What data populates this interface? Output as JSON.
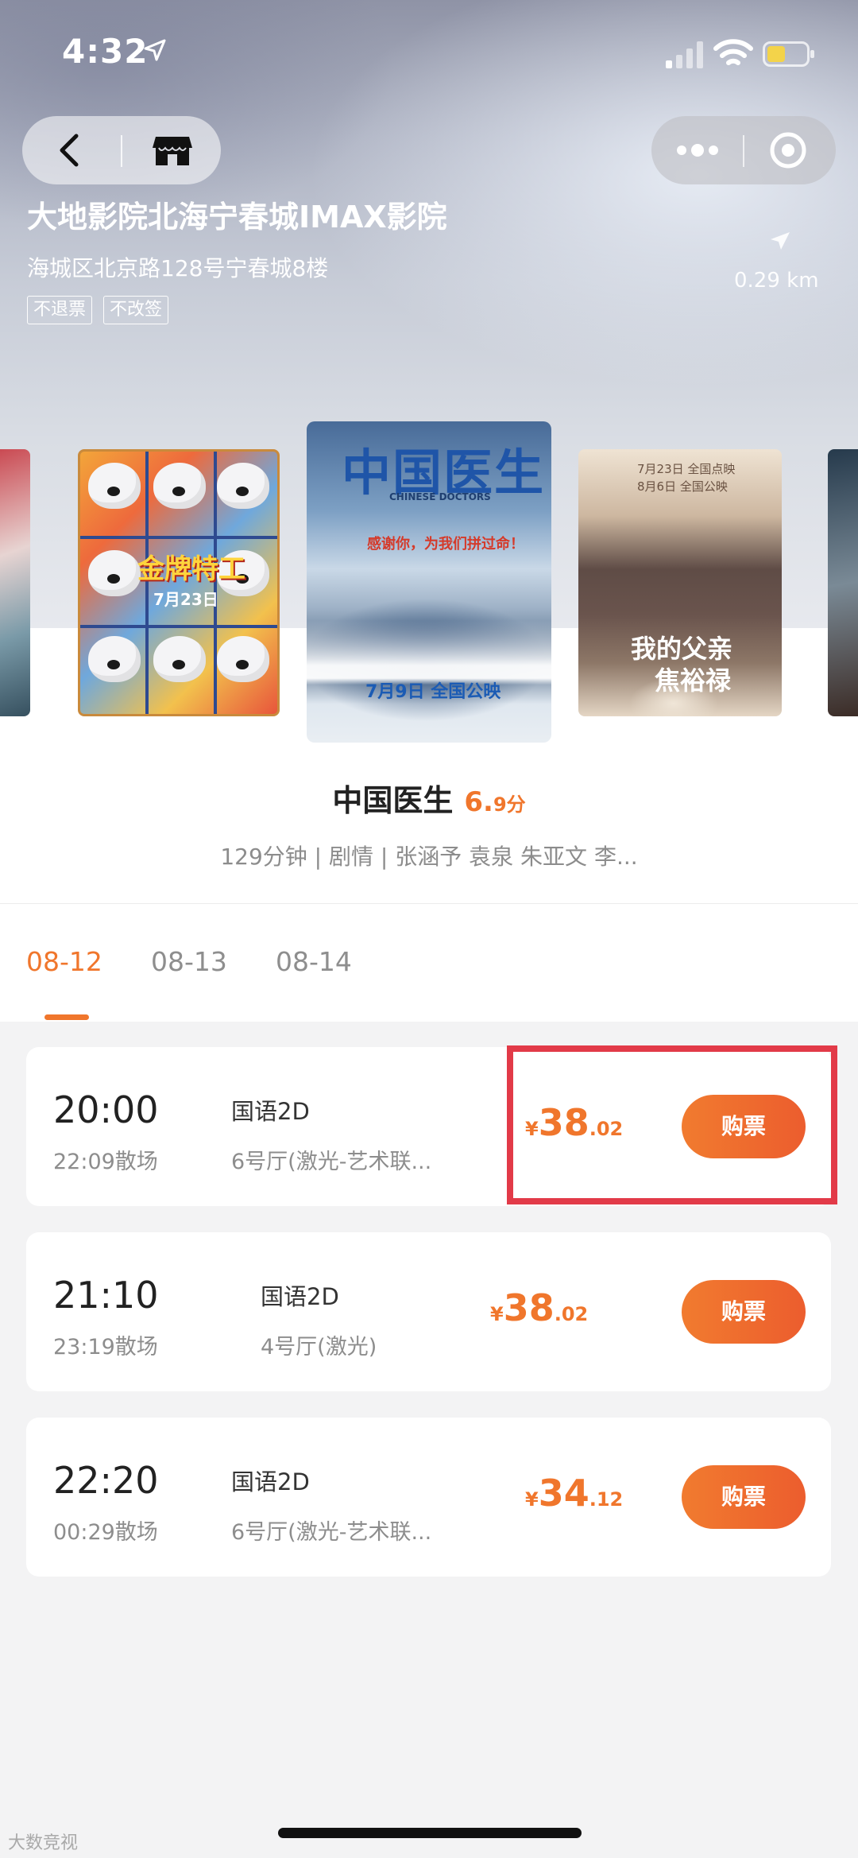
{
  "status_bar": {
    "time": "4:32"
  },
  "cinema": {
    "name": "大地影院北海宁春城IMAX影院",
    "address": "海城区北京路128号宁春城8楼",
    "tags": [
      "不退票",
      "不改签"
    ],
    "distance": "0.29 km"
  },
  "posters": {
    "left": {
      "title": "金牌特工",
      "date": "7月23日"
    },
    "center": {
      "title": "中国医生",
      "subtitle": "CHINESE DOCTORS",
      "slogan": "感谢你，为我们拼过命！",
      "release": "7月9日 全国公映"
    },
    "right": {
      "title_line1": "我的父亲",
      "title_line2": "焦裕禄",
      "date_line1": "7月23日 全国点映",
      "date_line2": "8月6日 全国公映"
    }
  },
  "movie": {
    "title": "中国医生",
    "score_int": "6.",
    "score_dec": "9分",
    "meta": "129分钟 | 剧情 | 张涵予 袁泉 朱亚文 李..."
  },
  "date_tabs": [
    "08-12",
    "08-13",
    "08-14"
  ],
  "showtimes": [
    {
      "time": "20:00",
      "end": "22:09散场",
      "lang": "国语2D",
      "hall": "6号厅(激光-艺术联...",
      "currency": "¥",
      "price_int": "38",
      "price_dec": ".02",
      "button": "购票"
    },
    {
      "time": "21:10",
      "end": "23:19散场",
      "lang": "国语2D",
      "hall": "4号厅(激光)",
      "currency": "¥",
      "price_int": "38",
      "price_dec": ".02",
      "button": "购票"
    },
    {
      "time": "22:20",
      "end": "00:29散场",
      "lang": "国语2D",
      "hall": "6号厅(激光-艺术联...",
      "currency": "¥",
      "price_int": "34",
      "price_dec": ".12",
      "button": "购票"
    }
  ],
  "watermark": "大数竞视",
  "colors": {
    "accent": "#f0762c",
    "highlight": "#e23a48"
  }
}
